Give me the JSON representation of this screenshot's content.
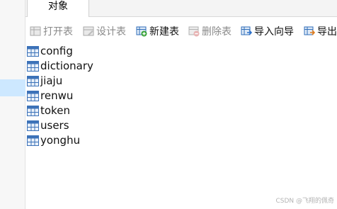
{
  "tabs": [
    {
      "label": "对象"
    }
  ],
  "toolbar": {
    "open_table": "打开表",
    "design_table": "设计表",
    "new_table": "新建表",
    "delete_table": "删除表",
    "import_wizard": "导入向导",
    "export_wizard": "导出"
  },
  "tables": [
    "config",
    "dictionary",
    "jiaju",
    "renwu",
    "token",
    "users",
    "yonghu"
  ],
  "watermark": "CSDN @飞翔的佩奇",
  "colors": {
    "table_icon": "#3c72b8",
    "selection": "#cde8ff",
    "new_green": "#3aa33a",
    "import_blue": "#2a6fc9",
    "export_orange": "#e07b1a"
  }
}
